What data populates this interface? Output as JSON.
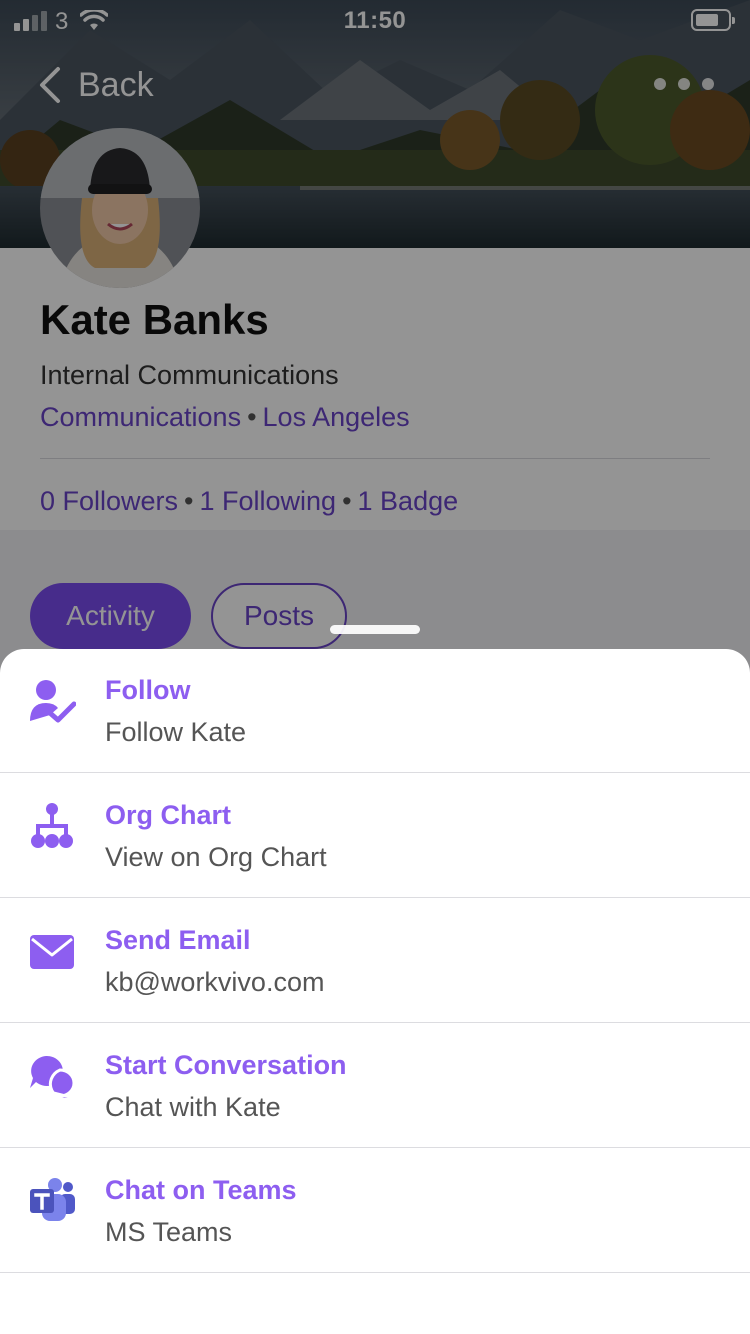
{
  "status_bar": {
    "carrier": "3",
    "time": "11:50"
  },
  "nav": {
    "back_label": "Back"
  },
  "profile": {
    "name": "Kate Banks",
    "job_title": "Internal Communications",
    "department": "Communications",
    "location": "Los Angeles",
    "separator": "•",
    "followers": "0 Followers",
    "following": "1 Following",
    "badges": "1 Badge"
  },
  "tabs": [
    {
      "label": "Activity",
      "active": true
    },
    {
      "label": "Posts",
      "active": false
    }
  ],
  "actions": [
    {
      "title": "Follow",
      "subtitle": "Follow Kate",
      "icon": "follow-user-check-icon"
    },
    {
      "title": "Org Chart",
      "subtitle": "View on Org Chart",
      "icon": "org-chart-icon"
    },
    {
      "title": "Send Email",
      "subtitle": "kb@workvivo.com",
      "icon": "envelope-icon"
    },
    {
      "title": "Start Conversation",
      "subtitle": "Chat with Kate",
      "icon": "chat-bubbles-icon"
    },
    {
      "title": "Chat on Teams",
      "subtitle": "MS Teams",
      "icon": "ms-teams-icon"
    }
  ],
  "colors": {
    "accent": "#8d5ef0",
    "accent_dark": "#6a44c8",
    "overlay": "rgba(0,0,0,0.42)"
  }
}
